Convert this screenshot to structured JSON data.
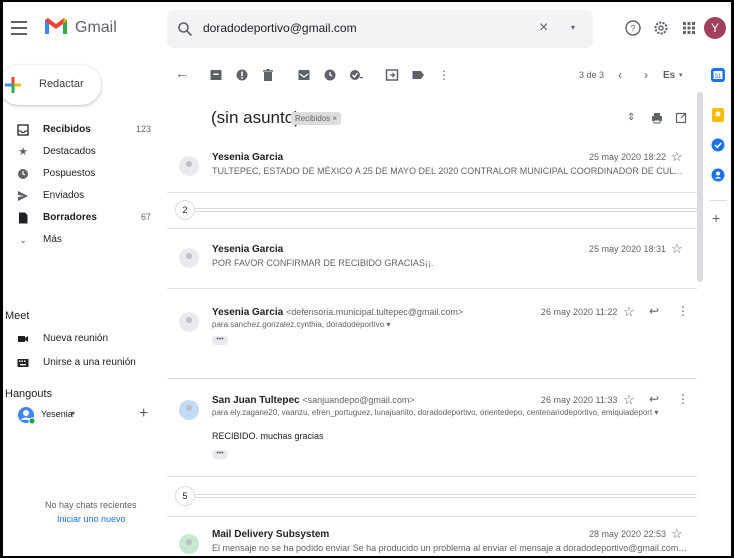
{
  "app": {
    "brand": "Gmail",
    "avatar_letter": "Y"
  },
  "search": {
    "query": "doradodeportivo@gmail.com",
    "clear": "×",
    "dropdown": "▾"
  },
  "compose": {
    "label": "Redactar"
  },
  "nav": [
    {
      "label": "Recibidos",
      "count": "123",
      "bold": true,
      "icon": "inbox-icon"
    },
    {
      "label": "Destacados",
      "count": "",
      "bold": false,
      "icon": "star-icon"
    },
    {
      "label": "Pospuestos",
      "count": "",
      "bold": false,
      "icon": "clock-icon"
    },
    {
      "label": "Enviados",
      "count": "",
      "bold": false,
      "icon": "send-icon"
    },
    {
      "label": "Borradores",
      "count": "67",
      "bold": true,
      "icon": "draft-icon"
    },
    {
      "label": "Más",
      "count": "",
      "bold": false,
      "icon": "chevron-down-icon"
    }
  ],
  "meet": {
    "title": "Meet",
    "new_meeting": "Nueva reunión",
    "join_meeting": "Unirse a una reunión"
  },
  "hangouts": {
    "title": "Hangouts",
    "user": "Yesenia",
    "user_caret": "▾",
    "add": "+",
    "no_chats": "No hay chats recientes",
    "start_new": "Iniciar uno nuevo"
  },
  "toolbar": {
    "pagination": "3 de 3",
    "lang": "Es",
    "lang_caret": "▾"
  },
  "thread": {
    "subject": "(sin asunto)",
    "label_chip": "Recibidos ×",
    "messages": [
      {
        "sender": "Yesenia Garcia",
        "email": "",
        "date": "25 may 2020 18:22",
        "snippet": "TULTEPEC, ESTADO DE MÉXICO A 25 DE MAYO DEL 2020 CONTRALOR MUNICIPAL COORDINADOR DE CULTURA F...",
        "recipients": "",
        "body": ""
      },
      {
        "sender": "Yesenia Garcia",
        "email": "",
        "date": "25 may 2020 18:31",
        "snippet": "POR FAVOR CONFIRMAR DE RECIBIDO GRACIAS¡¡.",
        "recipients": "",
        "body": ""
      },
      {
        "sender": "Yesenia Garcia",
        "email": "<defensoria.municipal.tultepec@gmail.com>",
        "date": "26 may 2020 11:22",
        "snippet": "",
        "recipients": "para sanchez.gonzalez.cynthia, doradodeportivo ▾",
        "body": ""
      },
      {
        "sender": "San Juan Tultepec",
        "email": "<sanjuandepo@gmail.com>",
        "date": "26 may 2020 11:33",
        "snippet": "",
        "recipients": "para ely.zagane20, vaanzu, efren_portuguez, lunajuanito, doradodeportivo, orientedepo, centenariodeportivo, emiquiadeport ▾",
        "body": "RECIBIDO.  muchas gracias"
      },
      {
        "sender": "Mail Delivery Subsystem",
        "email": "",
        "date": "28 may 2020 22:53",
        "snippet": "El mensaje no se ha podido enviar Se ha producido un problema al enviar el mensaje a doradodeportivo@gmail.com. Com",
        "recipients": "",
        "body": ""
      }
    ],
    "collapsed_1": "2",
    "collapsed_2": "5",
    "dots": "•••"
  },
  "colors": {
    "accent_red": "#d93025",
    "avatar": "#a0405b",
    "link_blue": "#1a73e8"
  }
}
